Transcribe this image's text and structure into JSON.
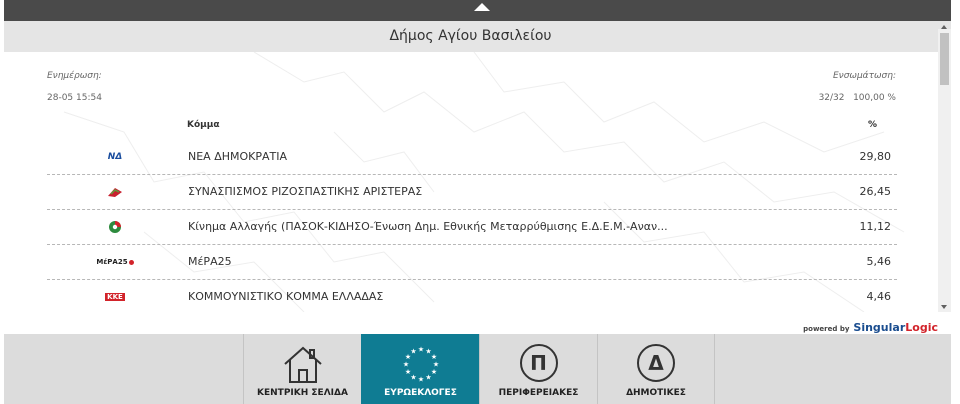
{
  "header": {
    "title": "Δήμος Αγίου Βασιλείου"
  },
  "meta": {
    "update_label": "Ενημέρωση:",
    "update_value": "28-05 15:54",
    "count_label": "Ενσωμάτωση:",
    "count_value": "32/32   100,00 %"
  },
  "table": {
    "col_party": "Κόμμα",
    "col_pct": "%",
    "rows": [
      {
        "name": "ΝΕΑ ΔΗΜΟΚΡΑΤΙΑ",
        "pct": "29,80",
        "logo": "nd-logo-icon"
      },
      {
        "name": "ΣΥΝΑΣΠΙΣΜΟΣ ΡΙΖΟΣΠΑΣΤΙΚΗΣ ΑΡΙΣΤΕΡΑΣ",
        "pct": "26,45",
        "logo": "syriza-logo-icon"
      },
      {
        "name": "Κίνημα Αλλαγής (ΠΑΣΟΚ-ΚΙΔΗΣΟ-Ένωση Δημ. Εθνικής Μεταρρύθμισης Ε.Δ.Ε.Μ.-Αναν...",
        "pct": "11,12",
        "logo": "kinal-logo-icon"
      },
      {
        "name": "ΜέΡΑ25",
        "pct": "5,46",
        "logo": "mera25-logo-icon"
      },
      {
        "name": "ΚΟΜΜΟΥΝΙΣΤΙΚΟ ΚΟΜΜΑ ΕΛΛΑΔΑΣ",
        "pct": "4,46",
        "logo": "kke-logo-icon"
      }
    ],
    "logo_texts": {
      "nd": "ΝΔ",
      "mera": "ΜέΡΑ25",
      "kke": "ΚΚΕ"
    }
  },
  "powered": {
    "prefix": "powered by",
    "brand1": "Singular",
    "brand2": "Logic"
  },
  "nav": {
    "tabs": [
      {
        "label": "ΚΕΝΤΡΙΚΗ ΣΕΛΙΔΑ",
        "icon": "home-icon"
      },
      {
        "label": "ΕΥΡΩΕΚΛΟΓΕΣ",
        "icon": "eu-stars-icon"
      },
      {
        "label": "ΠΕΡΙΦΕΡΕΙΑΚΕΣ",
        "icon": "pi-circle-icon",
        "glyph": "Π"
      },
      {
        "label": "ΔΗΜΟΤΙΚΕΣ",
        "icon": "delta-circle-icon",
        "glyph": "Δ"
      }
    ]
  },
  "colors": {
    "active_tab": "#0f7c93",
    "header_bg": "#e5e5e5",
    "topbar": "#4a4a4a"
  }
}
